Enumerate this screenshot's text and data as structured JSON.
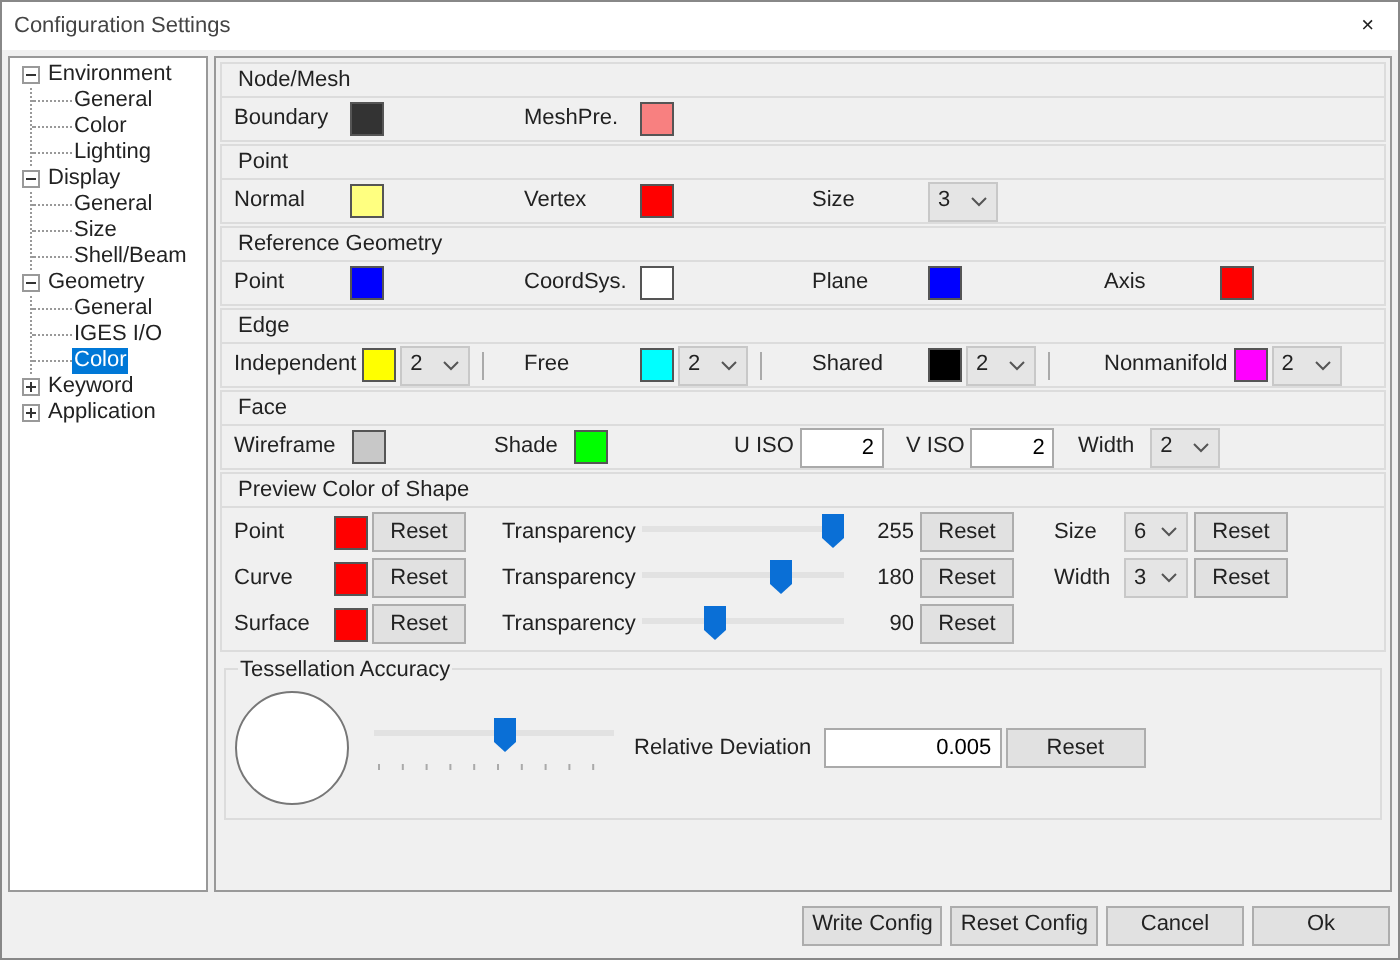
{
  "window": {
    "title": "Configuration Settings",
    "close": "×"
  },
  "tree": [
    {
      "label": "Environment",
      "expanded": true,
      "selected": false,
      "children": [
        {
          "label": "General",
          "selected": false
        },
        {
          "label": "Color",
          "selected": false
        },
        {
          "label": "Lighting",
          "selected": false
        }
      ]
    },
    {
      "label": "Display",
      "expanded": true,
      "selected": false,
      "children": [
        {
          "label": "General",
          "selected": false
        },
        {
          "label": "Size",
          "selected": false
        },
        {
          "label": "Shell/Beam",
          "selected": false
        }
      ]
    },
    {
      "label": "Geometry",
      "expanded": true,
      "selected": false,
      "children": [
        {
          "label": "General",
          "selected": false
        },
        {
          "label": "IGES I/O",
          "selected": false
        },
        {
          "label": "Color",
          "selected": true
        }
      ]
    },
    {
      "label": "Keyword",
      "expanded": false,
      "selected": false
    },
    {
      "label": "Application",
      "expanded": false,
      "selected": false
    }
  ],
  "sections": [
    {
      "title": "Node/Mesh",
      "kind": "grid",
      "items": [
        {
          "kind": "swatch",
          "label": "Boundary",
          "color": "#333333"
        },
        {
          "kind": "swatch",
          "label": "MeshPre.",
          "color": "#f88080"
        }
      ]
    },
    {
      "title": "Point",
      "kind": "grid",
      "items": [
        {
          "kind": "swatch",
          "label": "Normal",
          "color": "#ffff80"
        },
        {
          "kind": "swatch",
          "label": "Vertex",
          "color": "#ff0000"
        },
        {
          "kind": "combo",
          "label": "Size",
          "value": "3"
        }
      ]
    },
    {
      "title": "Reference Geometry",
      "kind": "grid",
      "items": [
        {
          "kind": "swatch",
          "label": "Point",
          "color": "#0000ff"
        },
        {
          "kind": "swatch",
          "label": "CoordSys.",
          "color": "#ffffff"
        },
        {
          "kind": "swatch",
          "label": "Plane",
          "color": "#0000ff"
        },
        {
          "kind": "swatch",
          "label": "Axis",
          "color": "#ff0000"
        }
      ]
    },
    {
      "title": "Edge",
      "kind": "grid",
      "items": [
        {
          "kind": "swatch_combo",
          "label": "Independent",
          "color": "#ffff00",
          "value": "2"
        },
        {
          "kind": "swatch_combo",
          "label": "Free",
          "color": "#00ffff",
          "value": "2"
        },
        {
          "kind": "swatch_combo",
          "label": "Shared",
          "color": "#000000",
          "value": "2"
        },
        {
          "kind": "swatch_combo",
          "label": "Nonmanifold",
          "color": "#ff00ff",
          "value": "2"
        }
      ]
    },
    {
      "title": "Face",
      "kind": "flow",
      "items": [
        {
          "kind": "swatch",
          "label": "Wireframe",
          "color": "#c8c8c8"
        },
        {
          "kind": "swatch",
          "label": "Shade",
          "color": "#00ff00"
        },
        {
          "kind": "field",
          "label": "U ISO",
          "value": "2"
        },
        {
          "kind": "field",
          "label": "V ISO",
          "value": "2"
        },
        {
          "kind": "combo",
          "label": "Width",
          "value": "2"
        }
      ]
    }
  ],
  "preview": {
    "title": "Preview Color of Shape",
    "rows": [
      {
        "label": "Point",
        "color": "#ff0000",
        "reset": "Reset",
        "transparency_label": "Transparency",
        "level": 1,
        "reading": "255",
        "transparency_reset": "Reset",
        "extra": {
          "label": "Size",
          "value": "6",
          "reset": "Reset"
        }
      },
      {
        "label": "Curve",
        "color": "#ff0000",
        "reset": "Reset",
        "transparency_label": "Transparency",
        "level": 0.71,
        "reading": "180",
        "transparency_reset": "Reset",
        "extra": {
          "label": "Width",
          "value": "3",
          "reset": "Reset"
        }
      },
      {
        "label": "Surface",
        "color": "#ff0000",
        "reset": "Reset",
        "transparency_label": "Transparency",
        "level": 0.35,
        "reading": "90",
        "transparency_reset": "Reset"
      }
    ]
  },
  "tessellation": {
    "title": "Tessellation Accuracy",
    "level": 0.55,
    "label": "Relative Deviation",
    "value": "0.005",
    "reset": "Reset"
  },
  "buttons": [
    "Write Config",
    "Reset Config",
    "Cancel",
    "Ok"
  ]
}
